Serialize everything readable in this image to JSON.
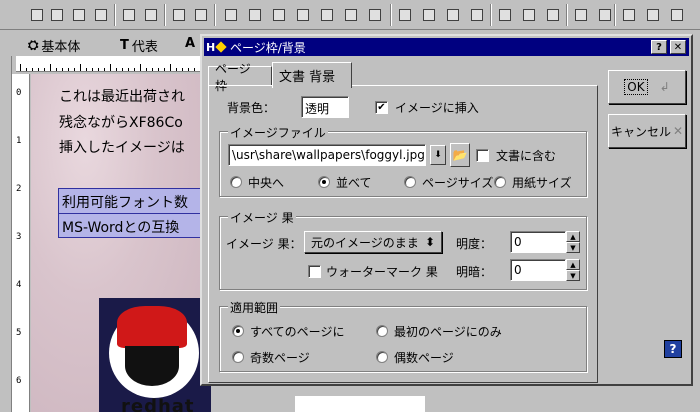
{
  "editor": {
    "format_toolbar": {
      "style_label": "基本体",
      "font_label": "代表",
      "font_icon": "T",
      "third_icon": "A"
    },
    "ruler_v_numbers": [
      "0",
      "1",
      "2",
      "3",
      "4",
      "5",
      "6"
    ],
    "document_lines": [
      "これは最近出荷され",
      "残念ながらXF86Co",
      "挿入したイメージは"
    ],
    "highlight_lines": [
      "利用可能フォント数",
      "MS-Wordとの互換"
    ],
    "logo_text": "redhat"
  },
  "dialog": {
    "title": "ページ枠/背景",
    "title_icon": "H",
    "help_button": "?",
    "close_button": "✕",
    "tabs": [
      {
        "label": "ページ 枠",
        "active": false
      },
      {
        "label": "文書 背景",
        "active": true
      }
    ],
    "background_color_label": "背景色：",
    "background_color_value": "透明",
    "insert_image_label": "イメージに挿入",
    "insert_image_checked": "✔",
    "image_file": {
      "group_title": "イメージファイル",
      "path": "\\usr\\share\\wallpapers\\foggyl.jpg",
      "include_in_doc_label": "文書に含む",
      "placement_options": [
        {
          "label": "中央へ",
          "selected": false
        },
        {
          "label": "並べて",
          "selected": true
        },
        {
          "label": "ページサイズ",
          "selected": false
        },
        {
          "label": "用紙サイズ",
          "selected": false
        }
      ]
    },
    "image_effect": {
      "group_title": "イメージ 果",
      "effect_label": "イメージ 果：",
      "effect_value": "元のイメージのまま",
      "brightness_label": "明度：",
      "brightness_value": "0",
      "watermark_label": "ウォーターマーク 果",
      "contrast_label": "明暗：",
      "contrast_value": "0"
    },
    "scope": {
      "group_title": "適用範囲",
      "options": [
        {
          "label": "すべてのページに",
          "selected": true
        },
        {
          "label": "最初のページにのみ",
          "selected": false
        },
        {
          "label": "奇数ページ",
          "selected": false
        },
        {
          "label": "偶数ページ",
          "selected": false
        }
      ]
    },
    "ok_button": "OK",
    "cancel_button": "キャンセル",
    "help_icon": "?"
  }
}
